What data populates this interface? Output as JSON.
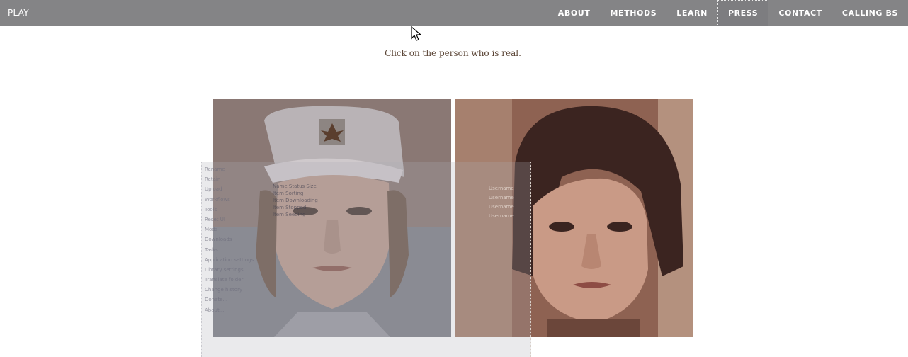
{
  "topbar": {
    "brand": "PLAY",
    "nav": [
      {
        "label": "ABOUT",
        "active": false
      },
      {
        "label": "METHODS",
        "active": false
      },
      {
        "label": "LEARN",
        "active": false
      },
      {
        "label": "PRESS",
        "active": true
      },
      {
        "label": "CONTACT",
        "active": false
      },
      {
        "label": "CALLING BS",
        "active": false
      }
    ]
  },
  "main": {
    "prompt": "Click on the person who is real."
  },
  "ghost_overlay": {
    "menu": [
      "Rename",
      "Retain",
      "Upload",
      "Workflows",
      "Tools",
      "Reset UI",
      "Mods",
      "Downloads",
      "Tasks",
      "Application settings...",
      "Library settings...",
      "Translate folder",
      "Change history",
      "Donate...",
      "About..."
    ],
    "table_rows": [
      "Name   Status   Size",
      "Item   Sorting",
      "Item   Downloading",
      "Item   Stopped",
      "Item   Seeding"
    ],
    "right_rows": [
      "Username",
      "Username",
      "Username",
      "Username"
    ]
  },
  "colors": {
    "topbar_bg": "#848486",
    "prompt_text": "#5b4536"
  }
}
